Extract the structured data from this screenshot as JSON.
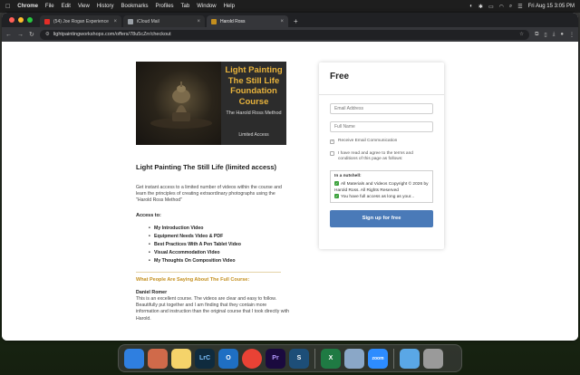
{
  "menubar": {
    "app": "Chrome",
    "items": [
      "File",
      "Edit",
      "View",
      "History",
      "Bookmarks",
      "Profiles",
      "Tab",
      "Window",
      "Help"
    ],
    "clock": "Fri Aug 15  3:05 PM"
  },
  "browser": {
    "tabs": [
      {
        "label": "(54) Joe Rogan Experience",
        "favicon_color": "#e52d27"
      },
      {
        "label": "iCloud Mail",
        "favicon_color": "#9aa0a6"
      },
      {
        "label": "Harold Ross",
        "favicon_color": "#c48f1e"
      }
    ],
    "new_tab": "+",
    "url": "lightpaintingworkshops.com/offers/78u5cZrr/checkout"
  },
  "hero": {
    "title": "Light Painting The Still Life Foundation Course",
    "subtitle": "The Harold Ross Method",
    "access": "Limited Access"
  },
  "course": {
    "title": "Light Painting The Still Life (limited access)",
    "description": "Get instant access to a limited number of videos within the course and learn the principles of creating extraordinary photographs using the \"Harold Ross Method\"",
    "access_heading": "Access to:",
    "access_items": [
      "My Introduction Video",
      "Equipment Needs Video & PDF",
      "Best Practices With A Pen Tablet Video",
      "Visual Accommodation Video",
      "My Thoughts On Composition Video"
    ],
    "testimonials_heading": "What People Are Saying About The Full Course:",
    "reviewer": "Daniel Romer",
    "review": "This is an excellent course. The videos are clear and easy to follow. Beautifully put together and I am finding that they contain more information and instruction than the original course that I took directly with Harold."
  },
  "checkout": {
    "price": "Free",
    "email_placeholder": "Email Address",
    "name_placeholder": "Full Name",
    "receive_email_label": "Receive Email Communication",
    "terms_label": "I have read and agree to the terms and conditions of this page as follows:",
    "nutshell_heading": "In a nutshell:",
    "nutshell_items": [
      "All Materials and Videos Copyright © 2026 by Harold Ross. All Rights Reserved",
      "You have full access as long as your..."
    ],
    "signup_label": "Sign up for free",
    "button_color": "#4a7ab8"
  },
  "dock": {
    "apps": [
      {
        "name": "Finder",
        "label": "",
        "color": "#2f7fe0"
      },
      {
        "name": "Launchpad",
        "label": "",
        "color": "#d06a4a"
      },
      {
        "name": "Notes",
        "label": "",
        "color": "#f5d36a"
      },
      {
        "name": "Lightroom Classic",
        "label": "LrC",
        "color": "#0f2b3e"
      },
      {
        "name": "Outlook",
        "label": "O",
        "color": "#1f6fc3"
      },
      {
        "name": "Chrome",
        "label": "",
        "color": "#e94235"
      },
      {
        "name": "Premiere",
        "label": "Pr",
        "color": "#1a0a3e"
      },
      {
        "name": "Surfshark",
        "label": "S",
        "color": "#1d4e78"
      },
      {
        "name": "Excel",
        "label": "X",
        "color": "#1f7a43"
      },
      {
        "name": "Preview",
        "label": "",
        "color": "#8aa7c7"
      },
      {
        "name": "Zoom",
        "label": "zoom",
        "color": "#2d8cff"
      },
      {
        "name": "Downloads",
        "label": "",
        "color": "#5aa7e6"
      },
      {
        "name": "Trash",
        "label": "",
        "color": "#9a9a9a"
      }
    ]
  }
}
